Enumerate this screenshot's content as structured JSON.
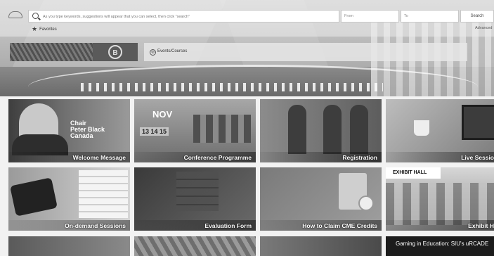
{
  "header": {
    "search_placeholder": "As you type keywords, suggestions will appear that you can select, then click \"search\"",
    "date_from_label": "From",
    "date_to_label": "To",
    "search_button": "Search",
    "favorites_label": "Favorites",
    "advanced_label": "Advanced"
  },
  "banner": {
    "events_label": "Events/Courses"
  },
  "tiles": {
    "welcome": {
      "label": "Welcome Message",
      "chair_line1": "Chair",
      "chair_line2": "Peter Black",
      "chair_line3": "Canada"
    },
    "conference": {
      "label": "Conference Programme",
      "month": "NOV",
      "dates": "13 14 15"
    },
    "registration": {
      "label": "Registration"
    },
    "live": {
      "label": "Live Sessio"
    },
    "ondemand": {
      "label": "On-demand Sessions"
    },
    "evaluation": {
      "label": "Evaluation Form"
    },
    "cme": {
      "label": "How to Claim CME Credits"
    },
    "exhibit": {
      "label": "Exhibit H",
      "sign": "EXHIBIT HALL"
    },
    "gaming": {
      "caption": "Gaming in Education: SIU's uRCADE"
    }
  }
}
